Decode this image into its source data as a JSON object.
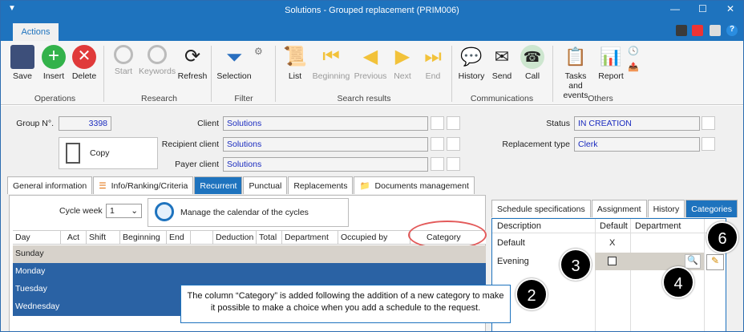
{
  "window": {
    "title": "Solutions - Grouped replacement (PRIM006)"
  },
  "ribbon_tab": "Actions",
  "ribbon": {
    "operations": {
      "label": "Operations",
      "save": "Save",
      "insert": "Insert",
      "delete": "Delete"
    },
    "research": {
      "label": "Research",
      "start": "Start",
      "keywords": "Keywords",
      "refresh": "Refresh"
    },
    "filter": {
      "label": "Filter",
      "selection": "Selection"
    },
    "search_results": {
      "label": "Search results",
      "list": "List",
      "beginning": "Beginning",
      "previous": "Previous",
      "next": "Next",
      "end": "End"
    },
    "communications": {
      "label": "Communications",
      "history": "History",
      "send": "Send",
      "call": "Call"
    },
    "others": {
      "label": "Others",
      "tasks": "Tasks and",
      "tasks2": "events",
      "report": "Report"
    }
  },
  "form": {
    "group_label": "Group N°.",
    "group_value": "3398",
    "copy": "Copy",
    "client_label": "Client",
    "client_value": "Solutions",
    "recipient_label": "Recipient client",
    "recipient_value": "Solutions",
    "payer_label": "Payer client",
    "payer_value": "Solutions",
    "status_label": "Status",
    "status_value": "IN CREATION",
    "reptype_label": "Replacement type",
    "reptype_value": "Clerk"
  },
  "tabs": [
    "General information",
    "Info/Ranking/Criteria",
    "Recurrent",
    "Punctual",
    "Replacements",
    "Documents management"
  ],
  "cycle": {
    "label": "Cycle week",
    "value": "1",
    "manage": "Manage the calendar of the cycles"
  },
  "grid": {
    "columns": [
      "Day",
      "Act",
      "Shift",
      "Beginning",
      "End",
      "",
      "Deduction",
      "Total",
      "Department",
      "Occupied by",
      "Category"
    ],
    "rows": [
      "Sunday",
      "Monday",
      "Tuesday",
      "Wednesday"
    ]
  },
  "right_tabs": [
    "Schedule specifications",
    "Assignment",
    "History",
    "Categories"
  ],
  "categories": {
    "headers": [
      "Description",
      "Default",
      "Department"
    ],
    "rows": [
      {
        "desc": "Default",
        "default": "X"
      },
      {
        "desc": "Evening",
        "default": ""
      }
    ]
  },
  "callout": "The column “Category” is added following the addition of a new category to make it possible to make a choice when you add a schedule to the request.",
  "markers": [
    "2",
    "3",
    "4",
    "6"
  ]
}
